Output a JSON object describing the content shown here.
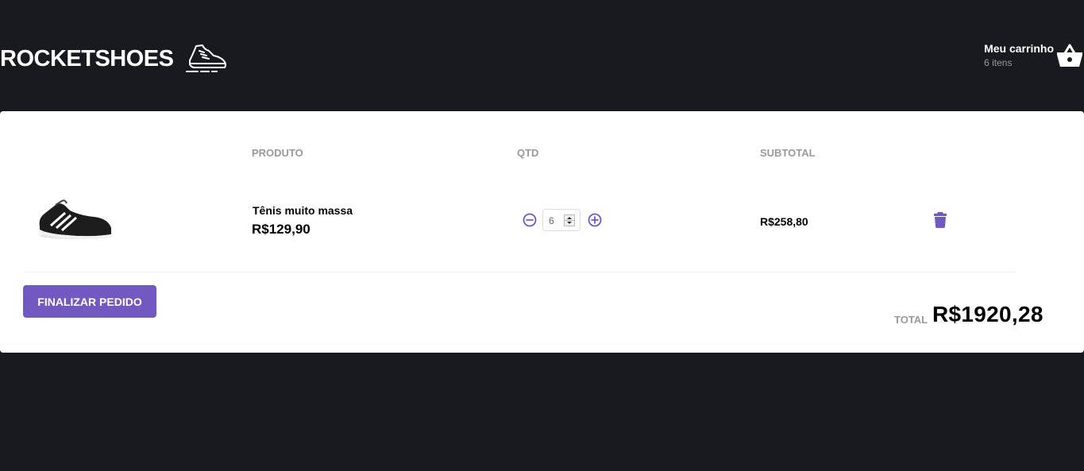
{
  "header": {
    "logo_text": "ROCKETSHOES",
    "cart_title": "Meu carrinho",
    "cart_count": "6 itens"
  },
  "table": {
    "headers": [
      "PRODUTO",
      "QTD",
      "SUBTOTAL"
    ],
    "rows": [
      {
        "title": "Tênis muito massa",
        "price": "R$129,90",
        "quantity": "6",
        "subtotal": "R$258,80"
      }
    ]
  },
  "footer": {
    "finish_label": "FINALIZAR PEDIDO",
    "total_label": "TOTAL",
    "total_value": "R$1920,28"
  },
  "icons": {
    "logo": "sneaker-icon",
    "cart": "basket-icon",
    "decrement": "minus-circle-icon",
    "increment": "plus-circle-icon",
    "delete": "trash-icon"
  },
  "colors": {
    "background": "#191920",
    "accent": "#7159c1",
    "panel": "#ffffff",
    "muted": "#999999"
  }
}
